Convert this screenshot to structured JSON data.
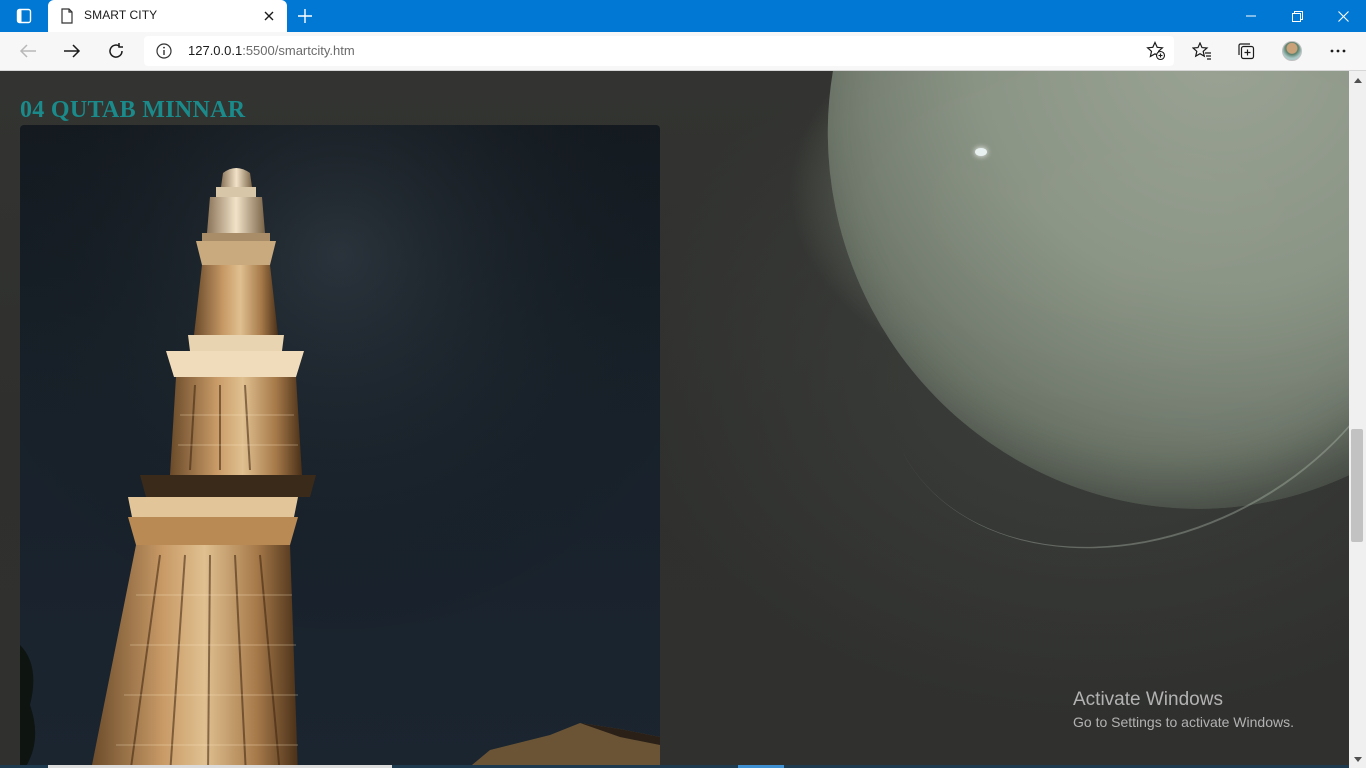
{
  "browser": {
    "tab": {
      "title": "SMART CITY"
    },
    "address": {
      "host": "127.0.0.1",
      "path": ":5500/smartcity.htm"
    }
  },
  "page": {
    "section_title": "04 QUTAB MINNAR"
  },
  "watermark": {
    "line1": "Activate Windows",
    "line2": "Go to Settings to activate Windows."
  },
  "scroll": {
    "position_fraction": 0.62,
    "visible_fraction": 0.17
  },
  "colors": {
    "titlebar": "#0078d4",
    "section_title": "#1a8a8a",
    "page_background": "#2f302e"
  }
}
